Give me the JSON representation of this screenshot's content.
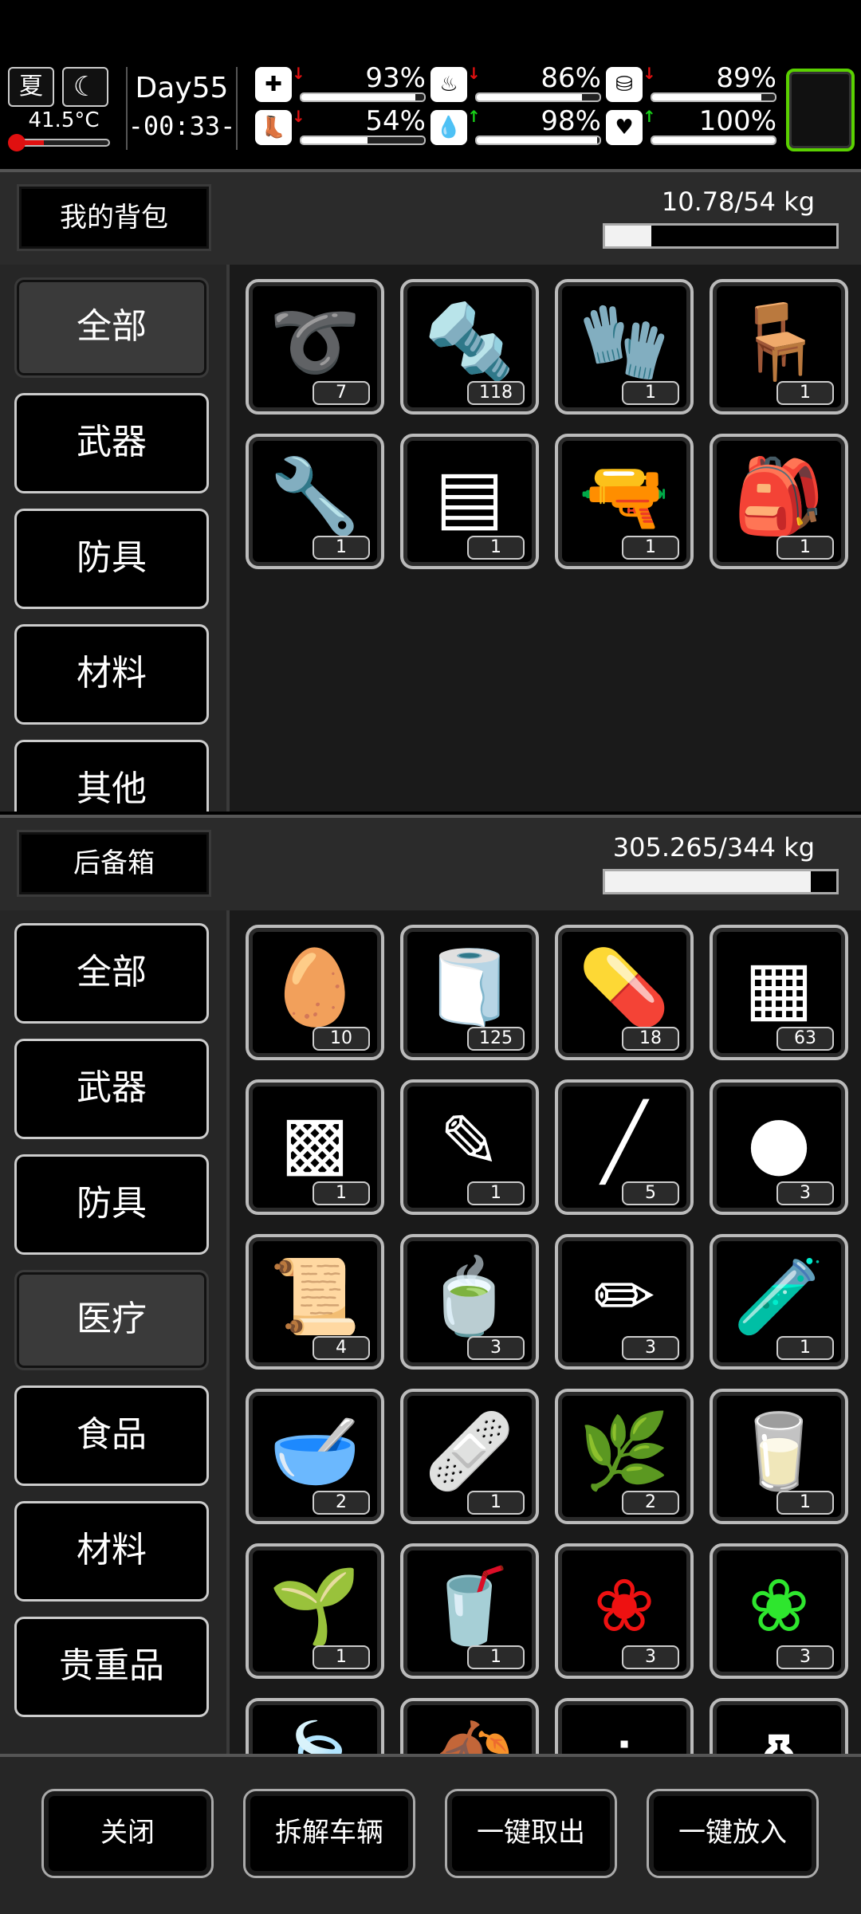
{
  "hud": {
    "season": "夏",
    "temperature": "41.5°C",
    "temperature_level": 0.3,
    "day": "Day55",
    "clock": "-00:33-",
    "stats": [
      {
        "icon": "medkit-icon",
        "glyph": "✚",
        "pct": "93%",
        "level": 0.93,
        "trend": "down"
      },
      {
        "icon": "stomach-icon",
        "glyph": "♨",
        "pct": "86%",
        "level": 0.86,
        "trend": "down"
      },
      {
        "icon": "bladder-icon",
        "glyph": "⛁",
        "pct": "89%",
        "level": 0.89,
        "trend": "down"
      },
      {
        "icon": "boot-icon",
        "glyph": "👢",
        "pct": "54%",
        "level": 0.54,
        "trend": "down"
      },
      {
        "icon": "water-drop-icon",
        "glyph": "💧",
        "pct": "98%",
        "level": 0.98,
        "trend": "up"
      },
      {
        "icon": "heart-icon",
        "glyph": "♥",
        "pct": "100%",
        "level": 1.0,
        "trend": "up"
      }
    ]
  },
  "backpack": {
    "title": "我的背包",
    "weight": "10.78/54 kg",
    "weight_level": 0.2,
    "categories": [
      "全部",
      "武器",
      "防具",
      "材料",
      "其他"
    ],
    "active": 0,
    "items": [
      {
        "icon": "rope-icon",
        "glyph": "➰",
        "count": "7"
      },
      {
        "icon": "screws-icon",
        "glyph": "🔩",
        "count": "118"
      },
      {
        "icon": "glove-icon",
        "glyph": "🧤",
        "count": "1"
      },
      {
        "icon": "folding-chair-icon",
        "glyph": "🪑",
        "count": "1"
      },
      {
        "icon": "pump-icon",
        "glyph": "🔧",
        "count": "1"
      },
      {
        "icon": "cloth-icon",
        "glyph": "▤",
        "count": "1"
      },
      {
        "icon": "spray-gun-icon",
        "glyph": "🔫",
        "count": "1"
      },
      {
        "icon": "backpack-icon",
        "glyph": "🎒",
        "count": "1"
      }
    ]
  },
  "trunk": {
    "title": "后备箱",
    "weight": "305.265/344 kg",
    "weight_level": 0.89,
    "categories": [
      "全部",
      "武器",
      "防具",
      "医疗",
      "食品",
      "材料",
      "贵重品"
    ],
    "active": 3,
    "items": [
      {
        "icon": "seeds-icon",
        "glyph": "🥚",
        "count": "10"
      },
      {
        "icon": "bandage-roll-icon",
        "glyph": "🧻",
        "count": "125"
      },
      {
        "icon": "pill-bottle-icon",
        "glyph": "💊",
        "count": "18"
      },
      {
        "icon": "tablet-tray-icon",
        "glyph": "▦",
        "count": "63"
      },
      {
        "icon": "blister-pack-icon",
        "glyph": "▩",
        "count": "1"
      },
      {
        "icon": "ointment-tube-icon",
        "glyph": "✎",
        "count": "1"
      },
      {
        "icon": "rolled-bandage-icon",
        "glyph": "╱",
        "count": "5"
      },
      {
        "icon": "pills-icon",
        "glyph": "●",
        "count": "3"
      },
      {
        "icon": "splint-icon",
        "glyph": "📜",
        "count": "4"
      },
      {
        "icon": "herbal-tea-icon",
        "glyph": "🍵",
        "count": "3"
      },
      {
        "icon": "cream-tube-icon",
        "glyph": "✏",
        "count": "3"
      },
      {
        "icon": "vials-icon",
        "glyph": "🧪",
        "count": "1"
      },
      {
        "icon": "bowl-icon",
        "glyph": "🥣",
        "count": "2"
      },
      {
        "icon": "gauze-icon",
        "glyph": "🩹",
        "count": "1"
      },
      {
        "icon": "herb-bundle-icon",
        "glyph": "🌿",
        "count": "2"
      },
      {
        "icon": "yellow-drink-icon",
        "glyph": "🥛",
        "count": "1",
        "color": "#f4c84a"
      },
      {
        "icon": "white-plant-icon",
        "glyph": "🌱",
        "count": "1"
      },
      {
        "icon": "green-drink-icon",
        "glyph": "🥤",
        "count": "1",
        "color": "#2ee62e"
      },
      {
        "icon": "red-herb-icon",
        "glyph": "❀",
        "count": "3",
        "color": "#ee1111"
      },
      {
        "icon": "green-herb-icon",
        "glyph": "❀",
        "count": "3",
        "color": "#2ee62e"
      },
      {
        "icon": "green-leaf-icon",
        "glyph": "🍃",
        "count": "",
        "color": "#2ee62e"
      },
      {
        "icon": "dried-leaf-icon",
        "glyph": "🍂",
        "count": "",
        "color": "#c8a860"
      },
      {
        "icon": "beans-icon",
        "glyph": "⁘",
        "count": ""
      },
      {
        "icon": "bottles-icon",
        "glyph": "⚱",
        "count": ""
      }
    ]
  },
  "bottom_buttons": [
    "关闭",
    "拆解车辆",
    "一键取出",
    "一键放入"
  ]
}
